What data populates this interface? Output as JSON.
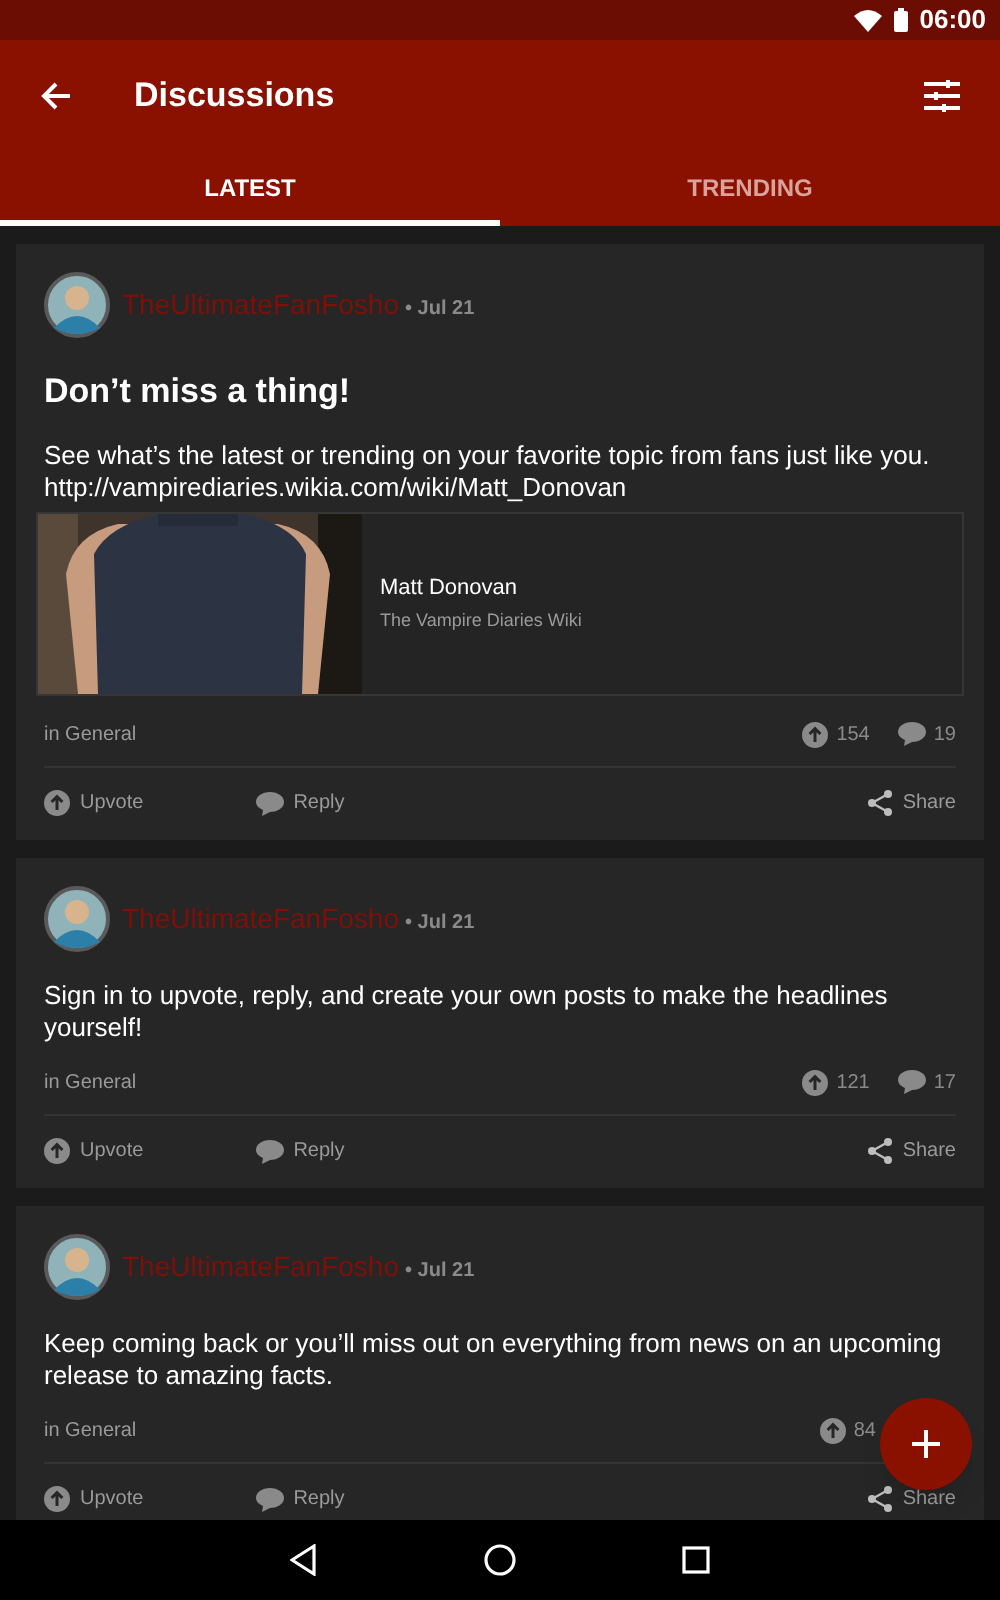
{
  "status_bar": {
    "time": "06:00"
  },
  "app_bar": {
    "title": "Discussions"
  },
  "tabs": [
    {
      "label": "LATEST",
      "selected": true
    },
    {
      "label": "TRENDING",
      "selected": false
    }
  ],
  "posts": [
    {
      "author": "TheUltimateFanFosho",
      "meta": "• Jul 21",
      "title": "Don’t miss a thing!",
      "body": "See what’s the latest or trending on your favorite topic from fans just like you. http://vampirediaries.wikia.com/wiki/Matt_Donovan",
      "link_preview": {
        "title": "Matt Donovan",
        "source": "The Vampire Diaries Wiki"
      },
      "category": "in General",
      "upvotes": "154",
      "comments": "19",
      "actions": [
        "Upvote",
        "Reply",
        "Share"
      ]
    },
    {
      "author": "TheUltimateFanFosho",
      "meta": "• Jul 21",
      "body": "Sign in to upvote, reply, and create your own posts to make the headlines yourself!",
      "category": "in General",
      "upvotes": "121",
      "comments": "17",
      "actions": [
        "Upvote",
        "Reply",
        "Share"
      ]
    },
    {
      "author": "TheUltimateFanFosho",
      "meta": "• Jul 21",
      "body": "Keep coming back or you’ll miss out on everything from news on an upcoming release to amazing facts.",
      "category": "in General",
      "upvotes": "84",
      "actions": [
        "Upvote",
        "Reply",
        "Share"
      ]
    }
  ]
}
